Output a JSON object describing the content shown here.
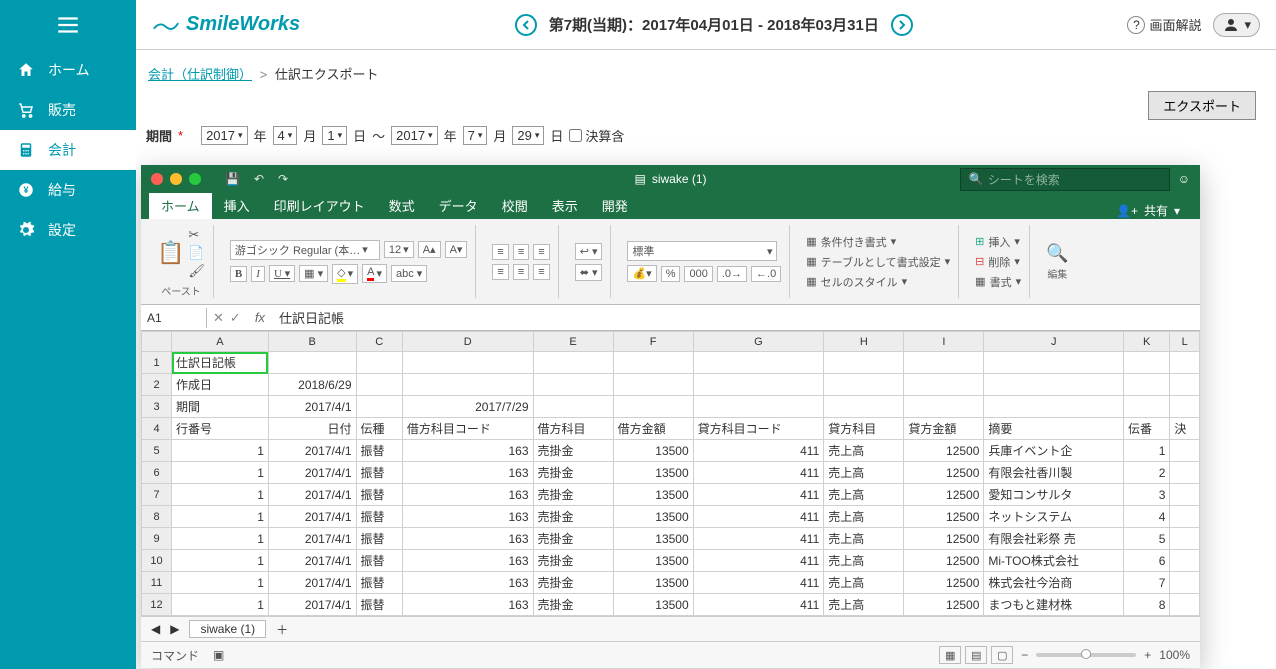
{
  "brand": "SmileWorks",
  "period_text": "第7期(当期)：2017年04月01日 - 2018年03月31日",
  "help_label": "画面解説",
  "nav": [
    {
      "label": "ホーム"
    },
    {
      "label": "販売"
    },
    {
      "label": "会計"
    },
    {
      "label": "給与"
    },
    {
      "label": "設定"
    }
  ],
  "breadcrumb": {
    "link": "会計（仕訳制御）",
    "sep": ">",
    "current": "仕訳エクスポート"
  },
  "export_btn": "エクスポート",
  "filter": {
    "label": "期間",
    "y1": "2017",
    "m1": "4",
    "d1": "1",
    "y2": "2017",
    "m2": "7",
    "d2": "29",
    "year": "年",
    "month": "月",
    "day": "日",
    "tilde": "～",
    "settlement": "決算含"
  },
  "excel": {
    "title": "siwake (1)",
    "search_placeholder": "シートを検索",
    "tabs": [
      "ホーム",
      "挿入",
      "印刷レイアウト",
      "数式",
      "データ",
      "校閲",
      "表示",
      "開発"
    ],
    "share": "共有",
    "paste": "ペースト",
    "font_name": "游ゴシック Regular (本…",
    "font_size": "12",
    "num_format": "標準",
    "cond_fmt": "条件付き書式",
    "table_fmt": "テーブルとして書式設定",
    "cell_style": "セルのスタイル",
    "insert": "挿入",
    "delete": "削除",
    "format": "書式",
    "edit": "編集",
    "namebox": "A1",
    "formula": "仕訳日記帳",
    "cols": [
      "",
      "A",
      "B",
      "C",
      "D",
      "E",
      "F",
      "G",
      "H",
      "I",
      "J",
      "K",
      "L"
    ],
    "rows": [
      [
        "1",
        "仕訳日記帳",
        "",
        "",
        "",
        "",
        "",
        "",
        "",
        "",
        "",
        "",
        ""
      ],
      [
        "2",
        "作成日",
        "2018/6/29",
        "",
        "",
        "",
        "",
        "",
        "",
        "",
        "",
        "",
        ""
      ],
      [
        "3",
        "期間",
        "2017/4/1",
        "",
        "2017/7/29",
        "",
        "",
        "",
        "",
        "",
        "",
        "",
        ""
      ],
      [
        "4",
        "行番号",
        "日付",
        "伝種",
        "借方科目コード",
        "借方科目",
        "借方金額",
        "貸方科目コード",
        "貸方科目",
        "貸方金額",
        "摘要",
        "伝番",
        "決"
      ],
      [
        "5",
        "1",
        "2017/4/1",
        "振替",
        "163",
        "売掛金",
        "13500",
        "411",
        "売上高",
        "12500",
        "兵庫イベント企",
        "1",
        ""
      ],
      [
        "6",
        "1",
        "2017/4/1",
        "振替",
        "163",
        "売掛金",
        "13500",
        "411",
        "売上高",
        "12500",
        "有限会社香川製",
        "2",
        ""
      ],
      [
        "7",
        "1",
        "2017/4/1",
        "振替",
        "163",
        "売掛金",
        "13500",
        "411",
        "売上高",
        "12500",
        "愛知コンサルタ",
        "3",
        ""
      ],
      [
        "8",
        "1",
        "2017/4/1",
        "振替",
        "163",
        "売掛金",
        "13500",
        "411",
        "売上高",
        "12500",
        "ネットシステム",
        "4",
        ""
      ],
      [
        "9",
        "1",
        "2017/4/1",
        "振替",
        "163",
        "売掛金",
        "13500",
        "411",
        "売上高",
        "12500",
        "有限会社彩祭 売",
        "5",
        ""
      ],
      [
        "10",
        "1",
        "2017/4/1",
        "振替",
        "163",
        "売掛金",
        "13500",
        "411",
        "売上高",
        "12500",
        "Mi-TOO株式会社",
        "6",
        ""
      ],
      [
        "11",
        "1",
        "2017/4/1",
        "振替",
        "163",
        "売掛金",
        "13500",
        "411",
        "売上高",
        "12500",
        "株式会社今治商",
        "7",
        ""
      ],
      [
        "12",
        "1",
        "2017/4/1",
        "振替",
        "163",
        "売掛金",
        "13500",
        "411",
        "売上高",
        "12500",
        "まつもと建材株",
        "8",
        ""
      ]
    ],
    "sheet_tab": "siwake (1)",
    "status": "コマンド",
    "zoom": "100%"
  }
}
